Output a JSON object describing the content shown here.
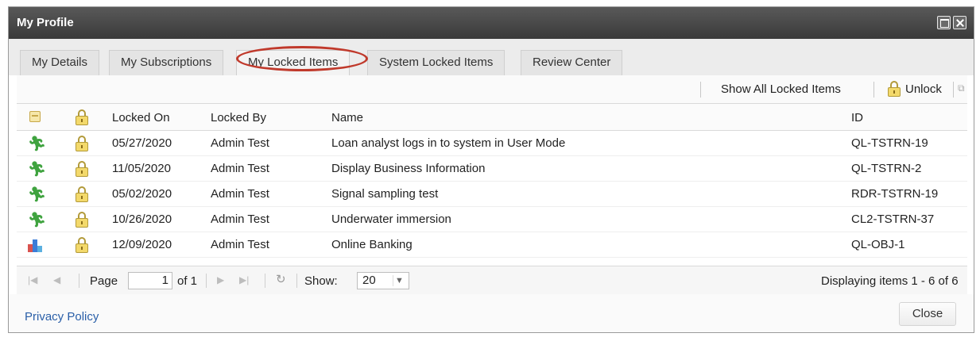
{
  "window": {
    "title": "My Profile"
  },
  "tabs": [
    {
      "label": "My Details"
    },
    {
      "label": "My Subscriptions"
    },
    {
      "label": "My Locked Items",
      "active": true,
      "highlighted": true
    },
    {
      "label": "System Locked Items"
    },
    {
      "label": "Review Center"
    }
  ],
  "toolbar": {
    "show_all_label": "Show All Locked Items",
    "unlock_label": "Unlock"
  },
  "grid": {
    "columns": [
      "Locked On",
      "Locked By",
      "Name",
      "ID"
    ],
    "rows": [
      {
        "type_icon": "runner-icon",
        "locked_on": "05/27/2020",
        "locked_by": "Admin Test",
        "name": "Loan analyst logs in to system in User Mode",
        "id": "QL-TSTRN-19"
      },
      {
        "type_icon": "runner-icon",
        "locked_on": "11/05/2020",
        "locked_by": "Admin Test",
        "name": "Display Business Information",
        "id": "QL-TSTRN-2"
      },
      {
        "type_icon": "runner-icon",
        "locked_on": "05/02/2020",
        "locked_by": "Admin Test",
        "name": "Signal sampling test",
        "id": "RDR-TSTRN-19"
      },
      {
        "type_icon": "runner-icon",
        "locked_on": "10/26/2020",
        "locked_by": "Admin Test",
        "name": "Underwater immersion",
        "id": "CL2-TSTRN-37"
      },
      {
        "type_icon": "objective-icon",
        "locked_on": "12/09/2020",
        "locked_by": "Admin Test",
        "name": "Online Banking",
        "id": "QL-OBJ-1"
      }
    ]
  },
  "pager": {
    "page_label": "Page",
    "page_value": "1",
    "of_label": "of 1",
    "show_label": "Show:",
    "page_size": "20",
    "status": "Displaying items 1 - 6 of 6"
  },
  "footer": {
    "privacy_label": "Privacy Policy",
    "close_label": "Close"
  },
  "colors": {
    "titlebar": "#3f3f3f",
    "highlight": "#c0392b",
    "link": "#2a5fa8",
    "runner": "#3fa33f"
  }
}
